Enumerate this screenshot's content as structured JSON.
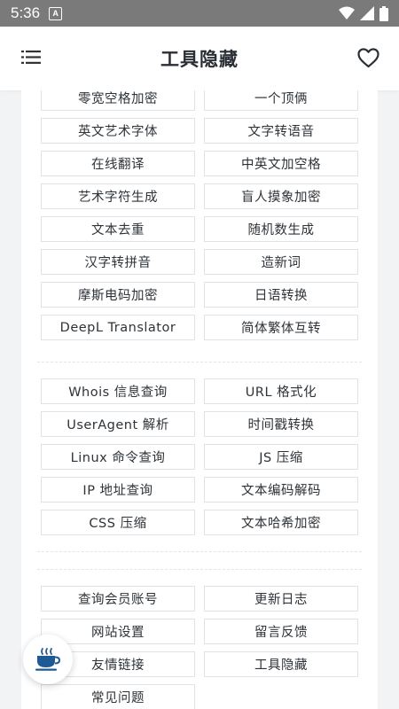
{
  "status_bar": {
    "time": "5:36",
    "notification_icon_letter": "A"
  },
  "header": {
    "title": "工具隐藏"
  },
  "sections": [
    {
      "items": [
        "零宽空格加密",
        "一个顶俩",
        "英文艺术字体",
        "文字转语音",
        "在线翻译",
        "中英文加空格",
        "艺术字符生成",
        "盲人摸象加密",
        "文本去重",
        "随机数生成",
        "汉字转拼音",
        "造新词",
        "摩斯电码加密",
        "日语转换",
        "DeepL Translator",
        "简体繁体互转"
      ]
    },
    {
      "items": [
        "Whois 信息查询",
        "URL 格式化",
        "UserAgent 解析",
        "时间戳转换",
        "Linux 命令查询",
        "JS 压缩",
        "IP 地址查询",
        "文本编码解码",
        "CSS 压缩",
        "文本哈希加密"
      ]
    },
    {
      "items": [
        "查询会员账号",
        "更新日志",
        "网站设置",
        "留言反馈",
        "友情链接",
        "工具隐藏",
        "常见问题"
      ]
    }
  ],
  "icons": {
    "menu": "hamburger-menu-icon",
    "favorite": "heart-outline-icon",
    "fab": "coffee-cup-icon"
  },
  "colors": {
    "status_bar": "#7a7a7a",
    "fab_icon": "#1f5a94",
    "background": "#f2f3f5"
  }
}
